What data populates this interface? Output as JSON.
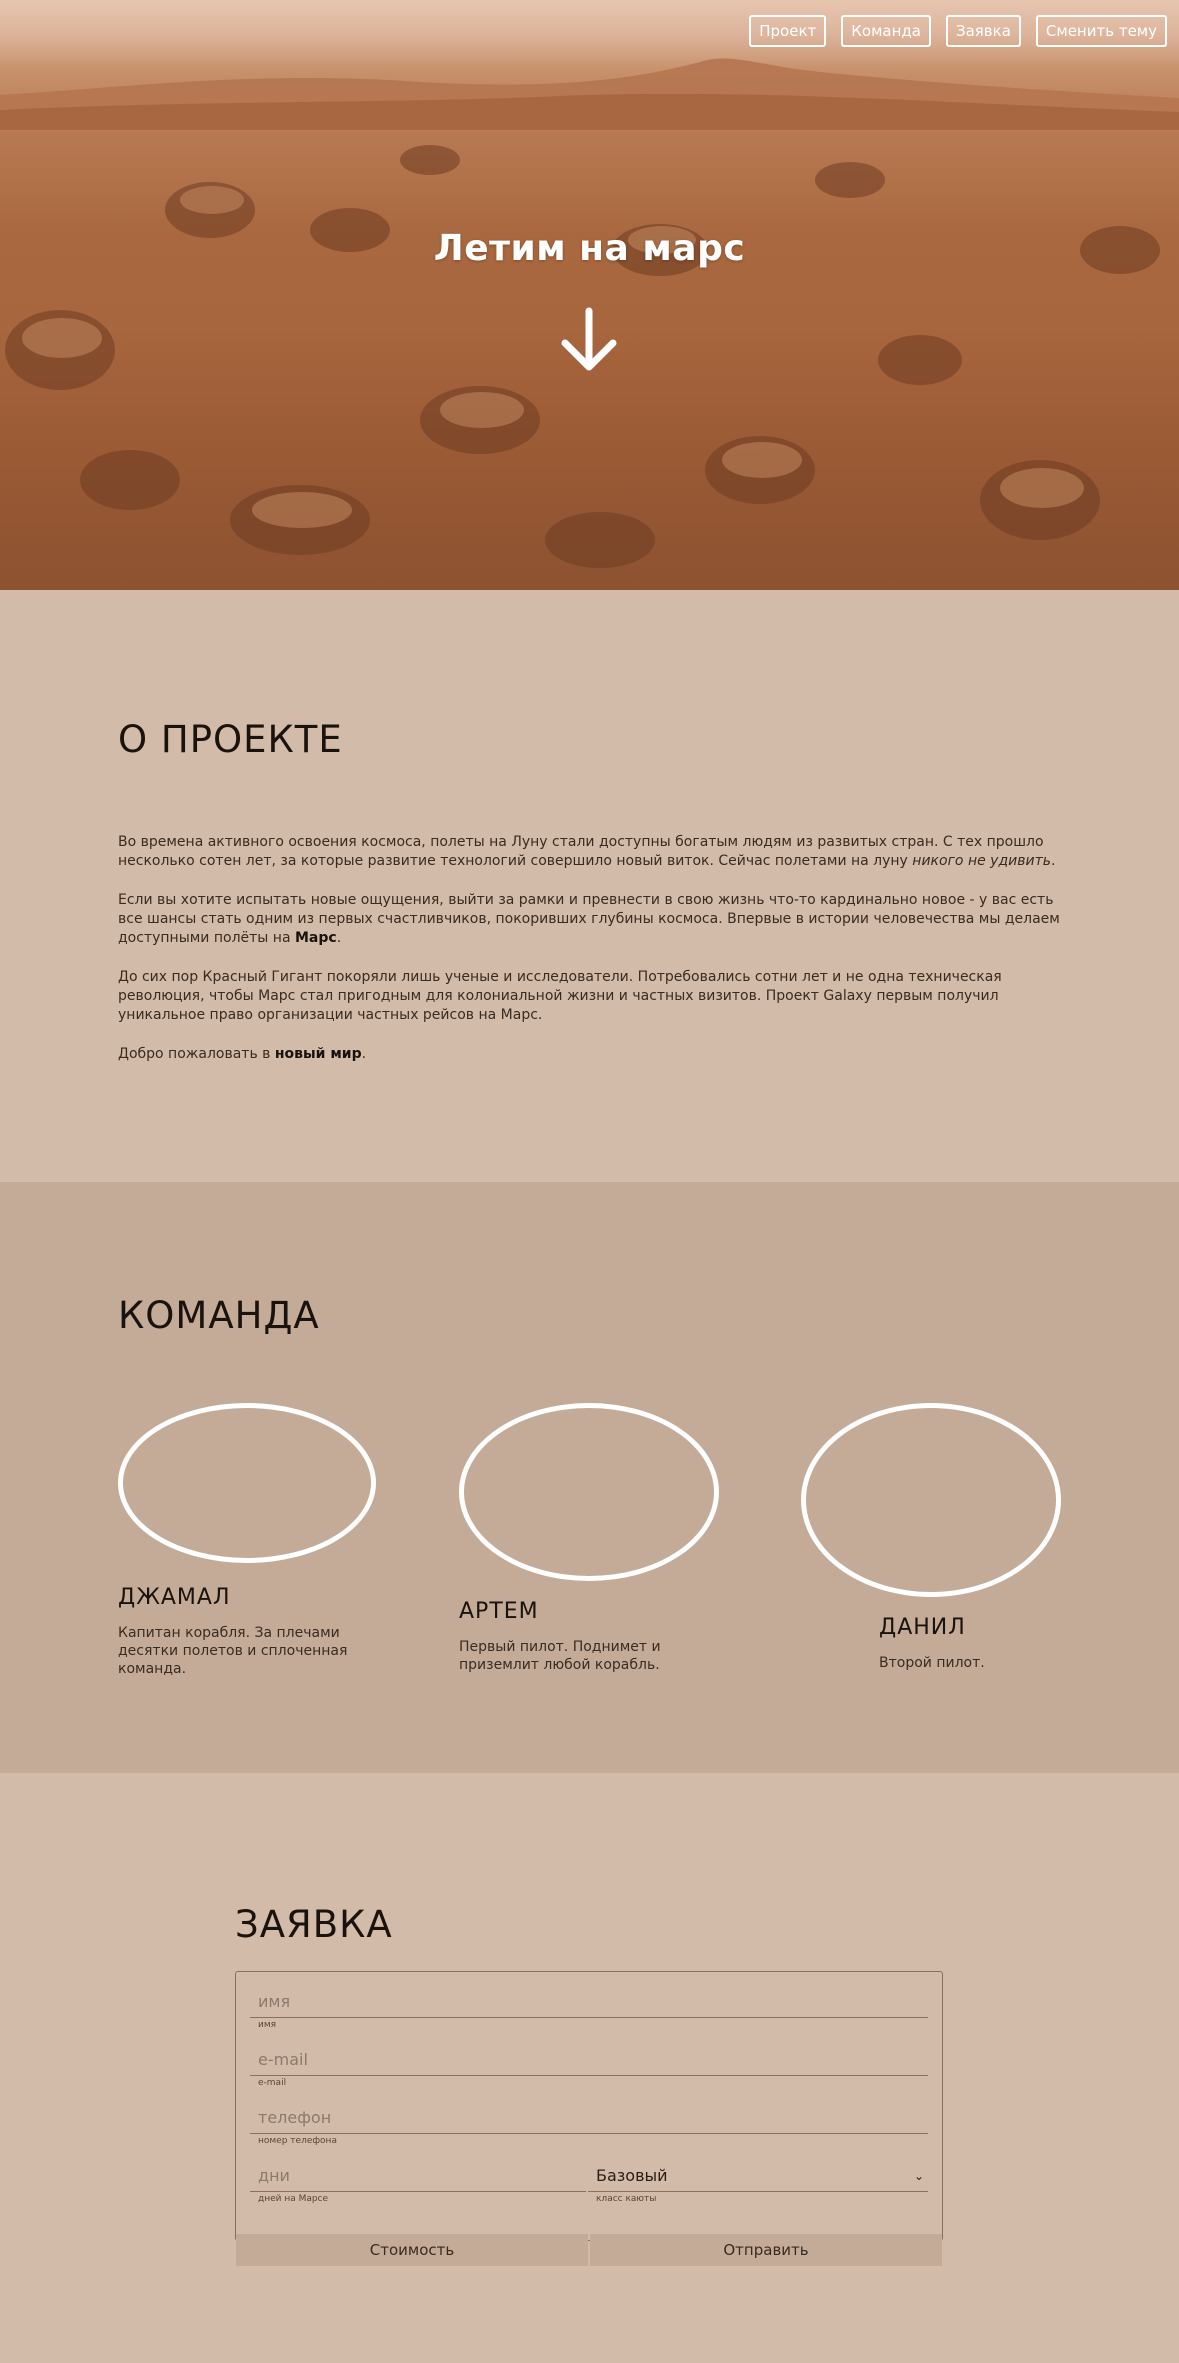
{
  "nav": {
    "items": [
      {
        "label": "Проект"
      },
      {
        "label": "Команда"
      },
      {
        "label": "Заявка"
      },
      {
        "label": "Сменить тему"
      }
    ]
  },
  "hero": {
    "title": "Летим на марс",
    "arrow_icon": "arrow-down-icon"
  },
  "about": {
    "heading": "О ПРОЕКТЕ",
    "p1_text": "Во времена активного освоения космоса, полеты на Луну стали доступны богатым людям из развитых стран. С тех прошло несколько сотен лет, за которые развитие технологий совершило новый виток. Сейчас полетами на луну ",
    "p1_italic": "никого не удивить",
    "p1_end": ".",
    "p2_text": "Если вы хотите испытать новые ощущения, выйти за рамки и превнести в свою жизнь что-то кардинально новое - у вас есть все шансы стать одним из первых счастливчиков, покоривших глубины космоса. Впервые в истории человечества мы делаем доступными полёты на ",
    "p2_bold": "Марс",
    "p2_end": ".",
    "p3_text": "До сих пор Красный Гигант покоряли лишь ученые и исследователи. Потребовались сотни лет и не одна техническая революция, чтобы Марс стал пригодным для колониальной жизни и частных визитов. Проект Galaxy первым получил уникальное право организации частных рейсов на Марс.",
    "p4_text": "Добро пожаловать в ",
    "p4_bold": "новый мир",
    "p4_end": "."
  },
  "team": {
    "heading": "КОМАНДА",
    "members": [
      {
        "name": "ДЖАМАЛ",
        "desc": "Капитан корабля. За плечами десятки полетов и сплоченная команда."
      },
      {
        "name": "АРТЕМ",
        "desc": "Первый пилот. Поднимет и приземлит любой корабль."
      },
      {
        "name": "ДАНИЛ",
        "desc": "Второй пилот."
      }
    ]
  },
  "order": {
    "heading": "ЗАЯВКА",
    "name": {
      "placeholder": "имя",
      "hint": "имя"
    },
    "email": {
      "placeholder": "e-mail",
      "hint": "e-mail"
    },
    "phone": {
      "placeholder": "телефон",
      "hint": "номер телефона"
    },
    "days": {
      "placeholder": "дни",
      "hint": "дней на Марсе"
    },
    "cabin": {
      "value": "Базовый",
      "hint": "класс каюты"
    },
    "cost_button": "Стоимость",
    "submit_button": "Отправить"
  },
  "colors": {
    "about_bg": "#d2bba8",
    "team_bg": "#c4ab98",
    "order_bg": "#d2bba8",
    "border": "#8a6f5c"
  }
}
